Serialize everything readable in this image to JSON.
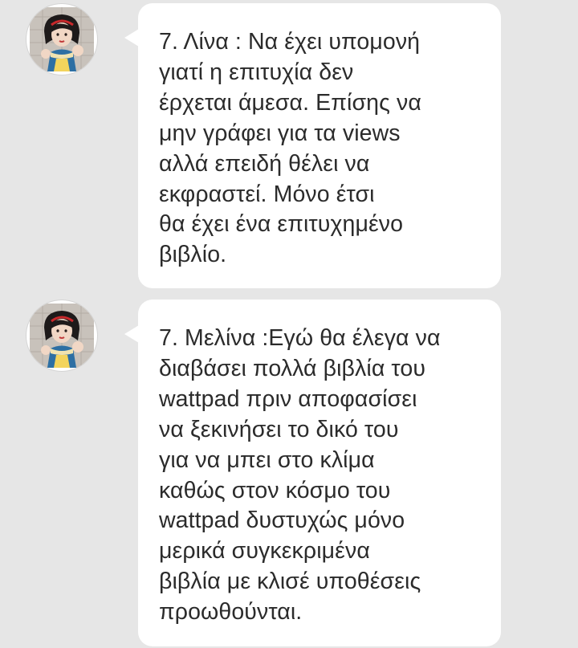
{
  "messages": [
    {
      "avatar": "profile-avatar-snow-white",
      "text": "7. Λίνα : Να έχει υπομονή\nγιατί η επιτυχία δεν\nέρχεται άμεσα. Επίσης να\nμην γράφει για τα views\nαλλά επειδή θέλει να\nεκφραστεί. Μόνο έτσι\nθα έχει ένα επιτυχημένο\nβιβλίο."
    },
    {
      "avatar": "profile-avatar-snow-white",
      "text": "7. Μελίνα :Εγώ θα έλεγα να\nδιαβάσει πολλά βιβλία του\nwattpad πριν αποφασίσει\nνα ξεκινήσει το δικό του\nγια να μπει στο κλίμα\nκαθώς στον κόσμο του\nwattpad δυστυχώς μόνο\nμερικά συγκεκριμένα\nβιβλία με κλισέ υποθέσεις\nπροωθούνται."
    }
  ],
  "colors": {
    "background": "#e6e6e6",
    "bubble": "#ffffff",
    "text": "#2b2b2b"
  }
}
